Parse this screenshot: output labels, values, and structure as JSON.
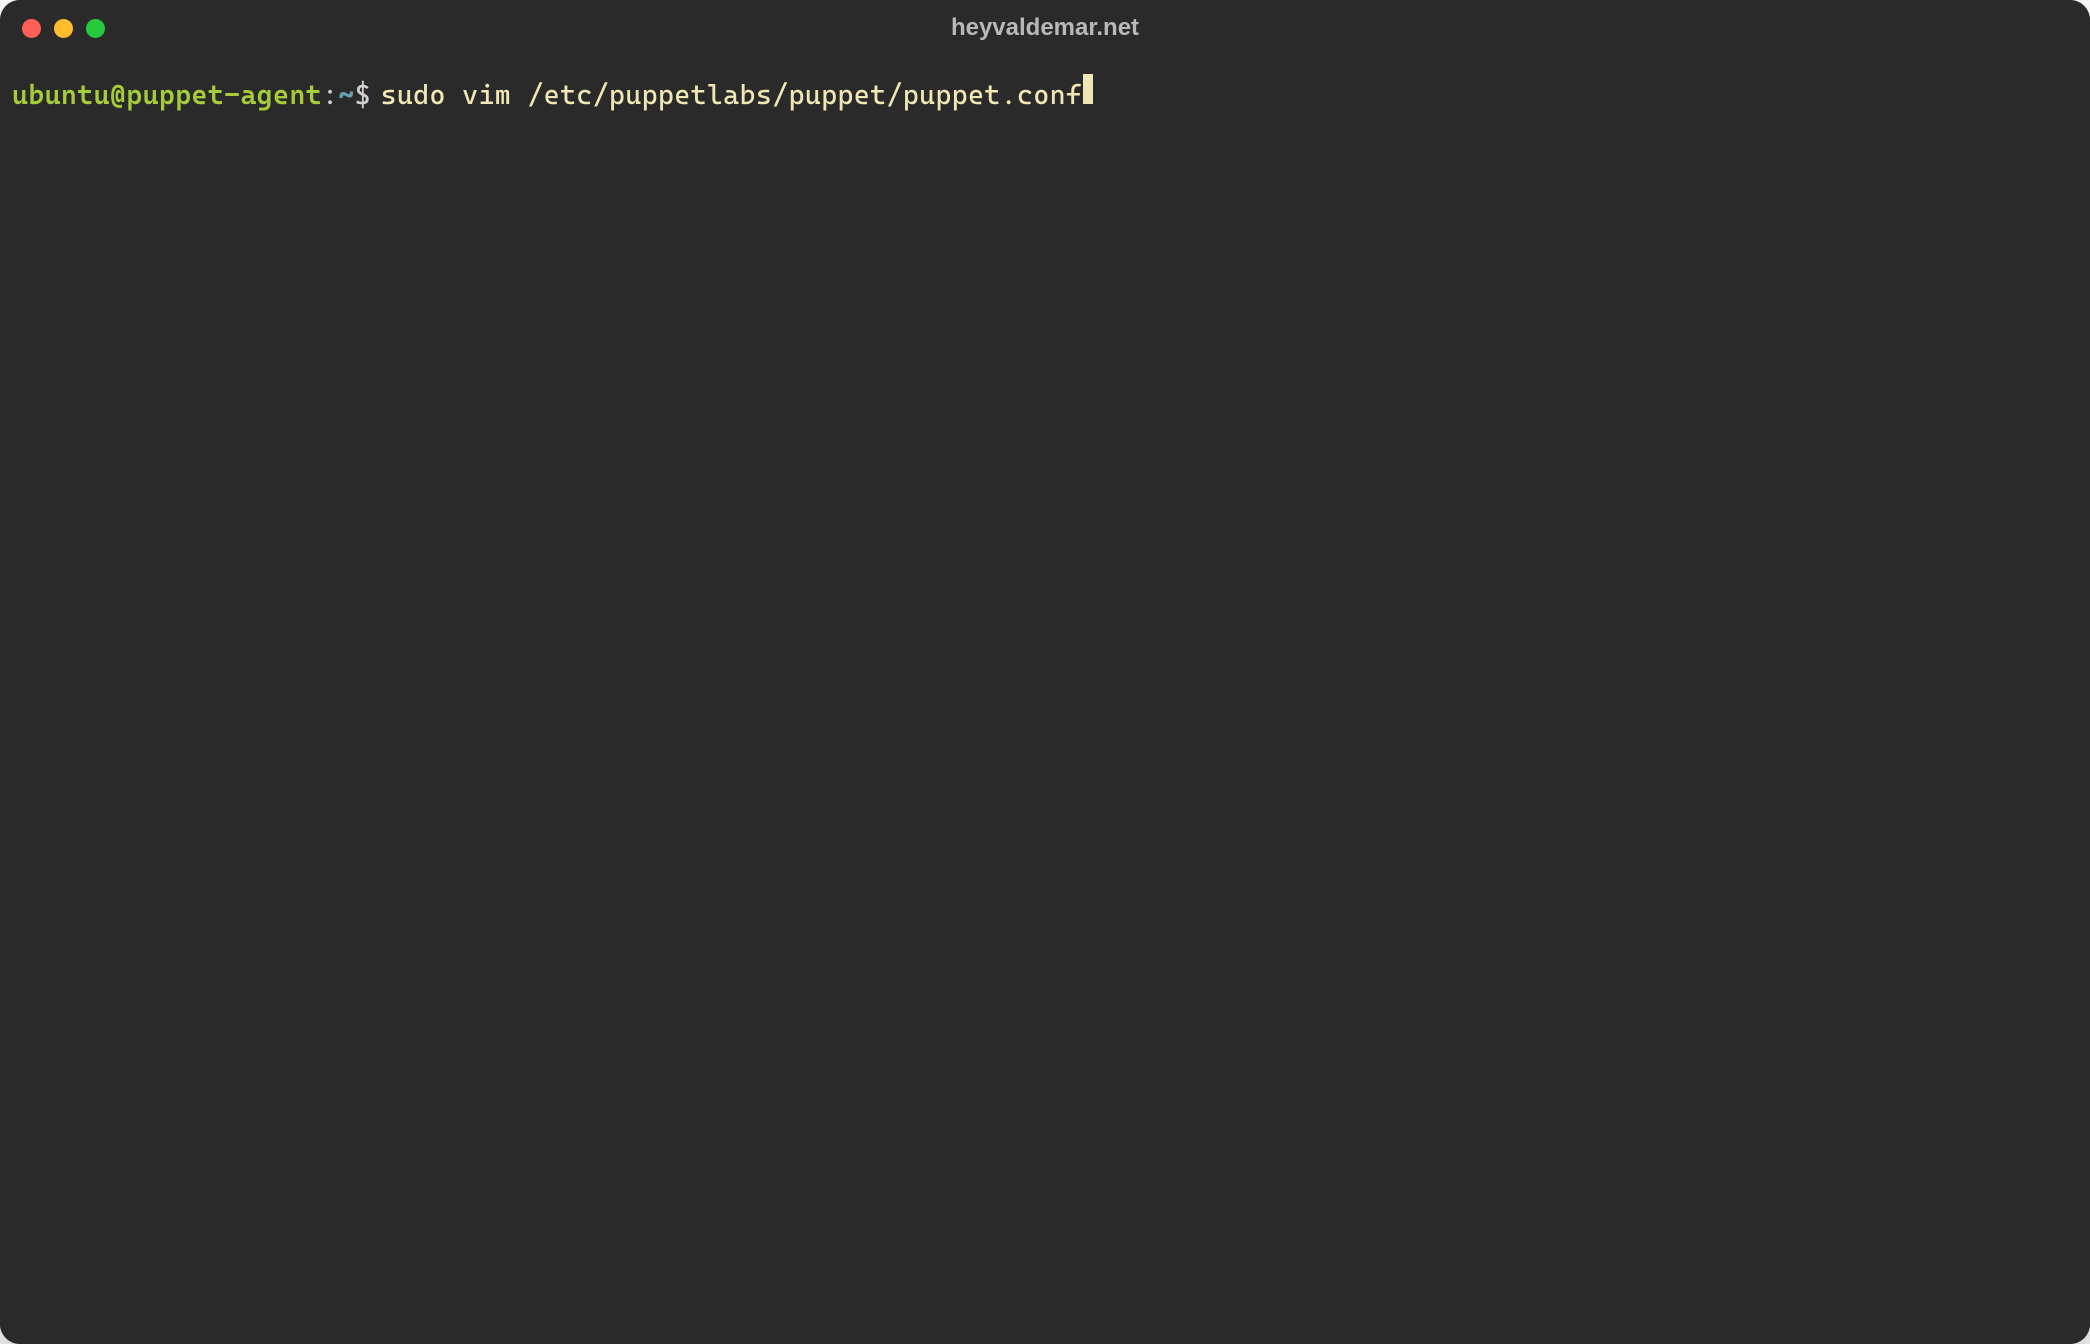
{
  "window": {
    "title": "heyvaldemar.net"
  },
  "colors": {
    "close": "#ff5f56",
    "minimize": "#ffbd2e",
    "zoom": "#27c93f",
    "background": "#2a2a2a",
    "prompt_user": "#a6cc3a",
    "prompt_path": "#6a9fb5",
    "command": "#f0e7b5"
  },
  "prompt": {
    "user_host": "ubuntu@puppet-agent",
    "separator": ":",
    "path": "~",
    "symbol": "$"
  },
  "command": {
    "text": "sudo vim /etc/puppetlabs/puppet/puppet.conf"
  }
}
